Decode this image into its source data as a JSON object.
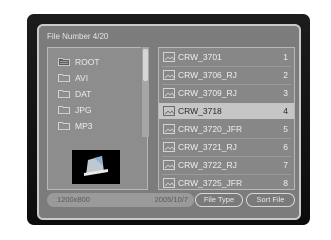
{
  "header": {
    "title": "File Number 4/20"
  },
  "folders": [
    {
      "label": "ROOT",
      "icon": "root-folder-icon"
    },
    {
      "label": "AVI",
      "icon": "folder-icon"
    },
    {
      "label": "DAT",
      "icon": "folder-icon"
    },
    {
      "label": "JPG",
      "icon": "folder-icon"
    },
    {
      "label": "MP3",
      "icon": "folder-icon"
    }
  ],
  "files": [
    {
      "name": "CRW_3701",
      "num": "1"
    },
    {
      "name": "CRW_3706_RJ",
      "num": "2"
    },
    {
      "name": "CRW_3709_RJ",
      "num": "3"
    },
    {
      "name": "CRW_3718",
      "num": "4",
      "selected": true
    },
    {
      "name": "CRW_3720_JFR",
      "num": "5"
    },
    {
      "name": "CRW_3721_RJ",
      "num": "6"
    },
    {
      "name": "CRW_3722_RJ",
      "num": "7"
    },
    {
      "name": "CRW_3725_JFR",
      "num": "8"
    }
  ],
  "status": {
    "resolution": "1200x800",
    "date": "2005/10/7"
  },
  "buttons": {
    "file_type": "File Type",
    "sort_file": "Sort File"
  },
  "colors": {
    "dialog_bg": "#7c7c7c",
    "selected_row": "#c6c6c6",
    "screen_bg": "#111111"
  }
}
